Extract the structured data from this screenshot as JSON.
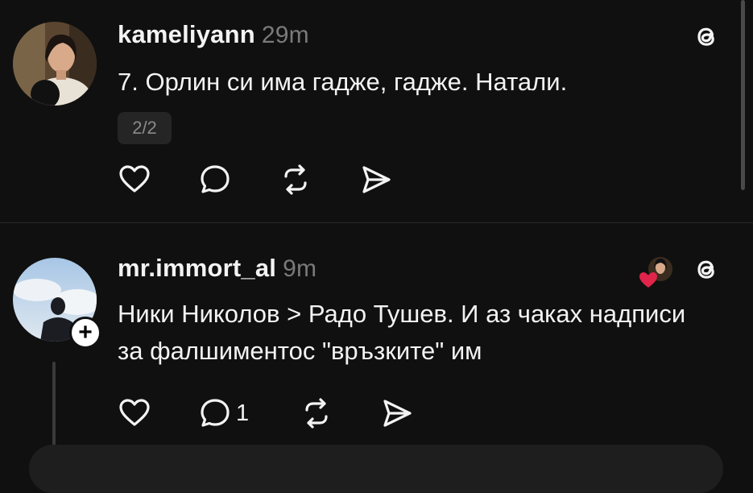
{
  "posts": [
    {
      "username": "kameliyann",
      "time": "29m",
      "text": "7. Орлин си има гадже, гадже. Натали.",
      "pager": "2/2",
      "avatar_icon": "profile-photo-woman",
      "logo_icon": "threads-icon"
    },
    {
      "username": "mr.immort_al",
      "time": "9m",
      "text": "Ники Николов > Радо Тушев. И аз чаках надписи за фалшиментос \"връзките\" им",
      "replies": "1",
      "avatar_icon": "profile-photo-man",
      "follow_symbol": "+",
      "liker_icon": "liked-by-avatar",
      "logo_icon": "threads-icon"
    }
  ],
  "colors": {
    "background": "#101010",
    "text": "#f3f3f3",
    "muted": "#7a7a7a",
    "like_heart": "#e0244a"
  }
}
